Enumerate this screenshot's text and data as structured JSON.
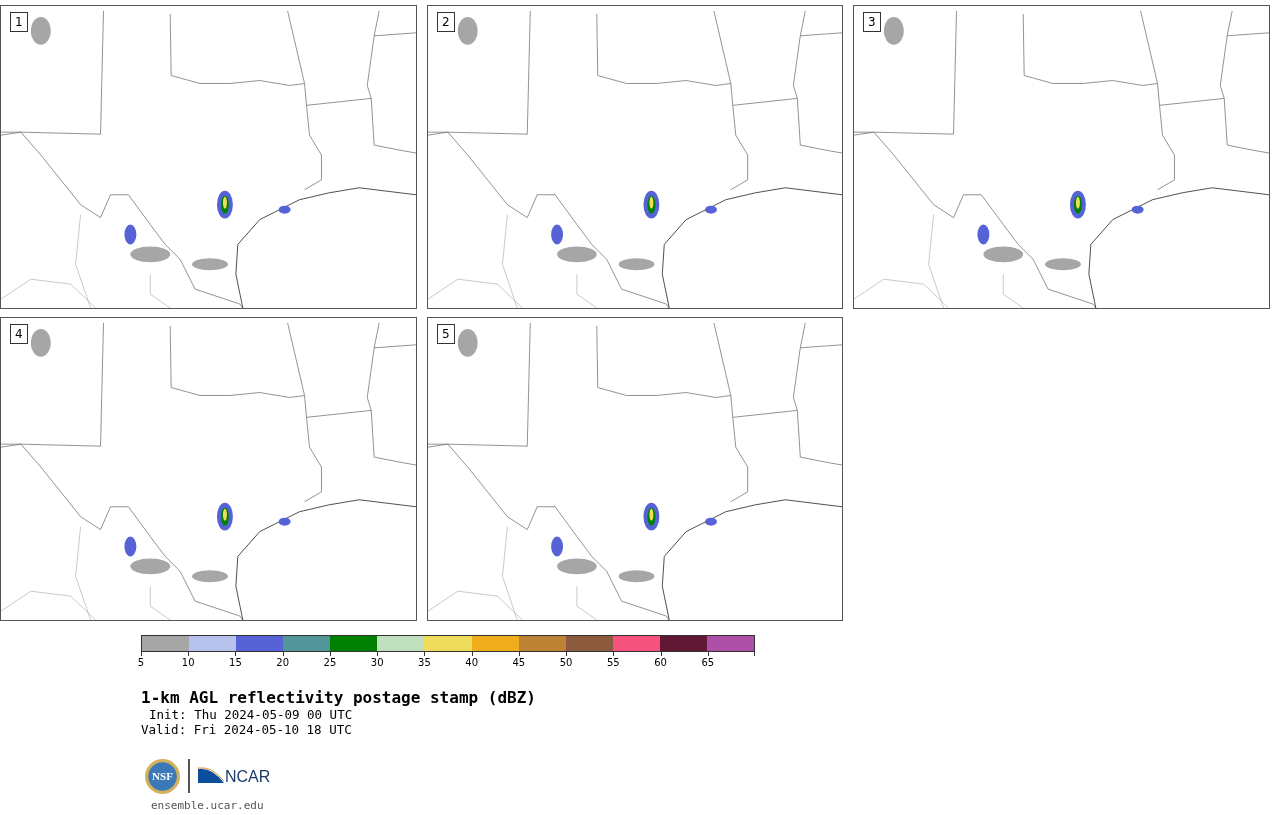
{
  "panels": [
    {
      "label": "1"
    },
    {
      "label": "2"
    },
    {
      "label": "3"
    },
    {
      "label": "4"
    },
    {
      "label": "5"
    }
  ],
  "colorbar": {
    "bins": [
      {
        "color": "#a6a6a6"
      },
      {
        "color": "#b6c1ec"
      },
      {
        "color": "#5563d6"
      },
      {
        "color": "#52969a"
      },
      {
        "color": "#008000"
      },
      {
        "color": "#bfdfbf"
      },
      {
        "color": "#eedd5d"
      },
      {
        "color": "#f0ad1b"
      },
      {
        "color": "#bb8333"
      },
      {
        "color": "#8c5b3e"
      },
      {
        "color": "#f5527e"
      },
      {
        "color": "#611835"
      },
      {
        "color": "#ad4fa6"
      }
    ],
    "ticks": [
      "5",
      "10",
      "15",
      "20",
      "25",
      "30",
      "35",
      "40",
      "45",
      "50",
      "55",
      "60",
      "65"
    ]
  },
  "title": "1-km AGL reflectivity postage stamp (dBZ)",
  "init": "Init: Thu 2024-05-09 00 UTC",
  "valid": "Valid: Fri 2024-05-10 18 UTC",
  "logo": {
    "left": "NSF",
    "right": "NCAR"
  },
  "footer": "ensemble.ucar.edu"
}
